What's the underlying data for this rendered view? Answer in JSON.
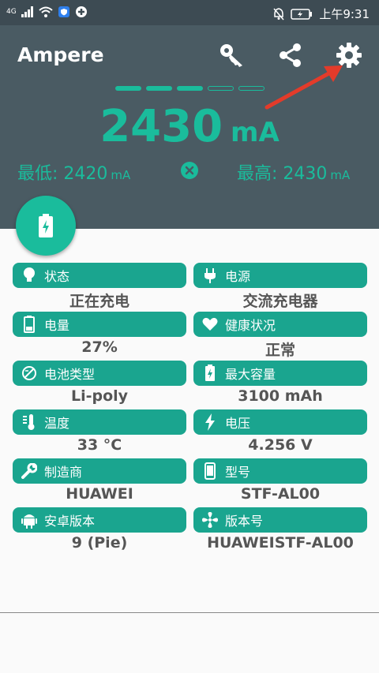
{
  "status_bar": {
    "network": "4G",
    "time": "上午9:31"
  },
  "header": {
    "title": "Ampere",
    "current_value": "2430",
    "current_unit": "mA",
    "min_label": "最低: 2420",
    "min_unit": "mA",
    "max_label": "最高: 2430",
    "max_unit": "mA",
    "level_dashes_filled": 3,
    "level_dashes_total": 5
  },
  "colors": {
    "accent": "#1abc9c",
    "header_bg": "#4a5b63",
    "statusbar_bg": "#3d4b53",
    "card_bg": "#1aa58f"
  },
  "cards": [
    {
      "icon": "lightbulb-icon",
      "label": "状态",
      "value": "正在充电"
    },
    {
      "icon": "power-plug-icon",
      "label": "电源",
      "value": "交流充电器"
    },
    {
      "icon": "battery-icon",
      "label": "电量",
      "value": "27%"
    },
    {
      "icon": "heart-icon",
      "label": "健康状况",
      "value": "正常"
    },
    {
      "icon": "battery-type-icon",
      "label": "电池类型",
      "value": "Li-poly"
    },
    {
      "icon": "battery-charging-icon",
      "label": "最大容量",
      "value": "3100 mAh"
    },
    {
      "icon": "thermometer-icon",
      "label": "温度",
      "value": "33 °C"
    },
    {
      "icon": "lightning-icon",
      "label": "电压",
      "value": "4.256 V"
    },
    {
      "icon": "wrench-icon",
      "label": "制造商",
      "value": "HUAWEI"
    },
    {
      "icon": "phone-icon",
      "label": "型号",
      "value": "STF-AL00"
    },
    {
      "icon": "android-icon",
      "label": "安卓版本",
      "value": "9 (Pie)"
    },
    {
      "icon": "fan-icon",
      "label": "版本号",
      "value": "HUAWEISTF-AL00"
    }
  ]
}
